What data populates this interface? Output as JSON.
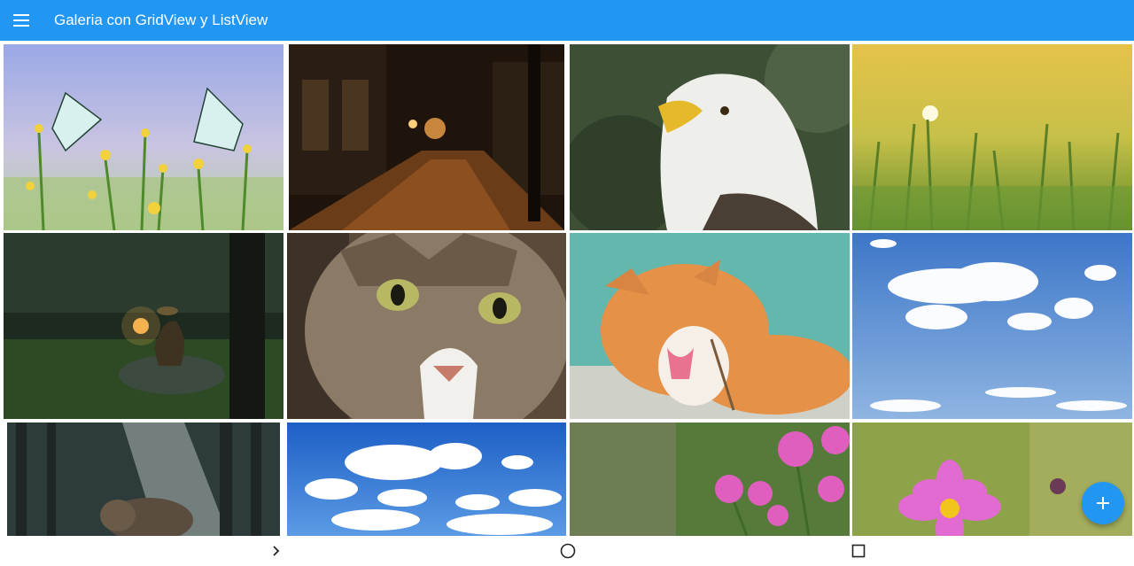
{
  "app_bar": {
    "title": "Galeria con GridView y ListView",
    "menu_icon": "menu-icon",
    "color": "#2196f3"
  },
  "gallery": {
    "images": [
      {
        "subject": "butterflies-on-flowers"
      },
      {
        "subject": "night-street"
      },
      {
        "subject": "bald-eagle"
      },
      {
        "subject": "wheat-field-sunrise"
      },
      {
        "subject": "boy-with-lantern"
      },
      {
        "subject": "tabby-cat"
      },
      {
        "subject": "orange-cat"
      },
      {
        "subject": "clouds-blue-sky"
      },
      {
        "subject": "elephant-forest"
      },
      {
        "subject": "clouds-blue-sky-2"
      },
      {
        "subject": "pink-flowers"
      },
      {
        "subject": "pink-cosmos"
      }
    ]
  },
  "fab": {
    "icon": "plus-icon",
    "color": "#2196f3"
  },
  "nav_bar": {
    "back_icon": "back-chevron-icon",
    "home_icon": "home-circle-icon",
    "recents_icon": "recents-square-icon"
  }
}
